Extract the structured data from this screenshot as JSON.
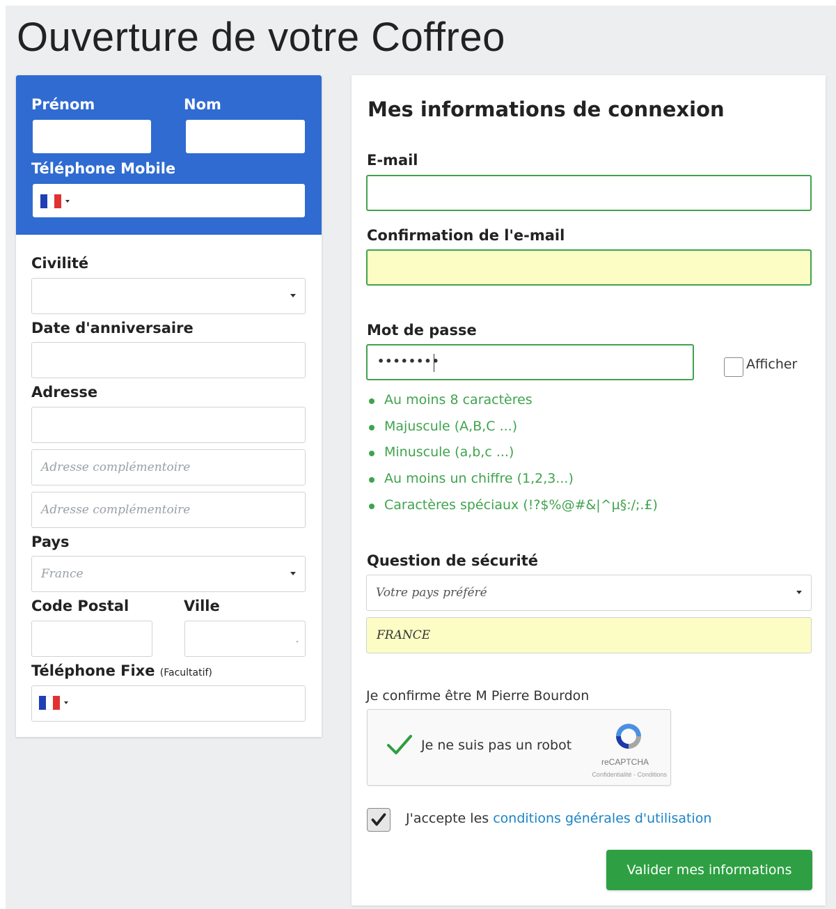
{
  "page": {
    "title": "Ouverture de votre Coffreo"
  },
  "left": {
    "prenom_label": "Prénom",
    "nom_label": "Nom",
    "mobile_label": "Téléphone Mobile",
    "civilite_label": "Civilité",
    "birthday_label": "Date d'anniversaire",
    "address_label": "Adresse",
    "address2_placeholder": "Adresse complémentoire",
    "address3_placeholder": "Adresse complémentoire",
    "country_label": "Pays",
    "country_value": "France",
    "postal_label": "Code Postal",
    "city_label": "Ville",
    "landline_label": "Téléphone Fixe",
    "landline_optional": "(Facultatif)"
  },
  "right": {
    "section_title": "Mes informations de connexion",
    "email_label": "E-mail",
    "email_confirm_label": "Confirmation de l'e-mail",
    "password_label": "Mot de passe",
    "password_value": "••••••••",
    "show_label": "Afficher",
    "password_rules": [
      "Au moins 8 caractères",
      "Majuscule (A,B,C ...)",
      "Minuscule (a,b,c ...)",
      "Au moins un chiffre (1,2,3...)",
      "Caractères spéciaux (!?$%@#&|^µ§:/;.£)"
    ],
    "security_label": "Question de sécurité",
    "security_question": "Votre pays préféré",
    "security_answer": "FRANCE",
    "confirm_identity": "Je confirme être M Pierre Bourdon",
    "captcha_text": "Je ne suis pas un robot",
    "captcha_brand": "reCAPTCHA",
    "captcha_legal": "Confidentialité - Conditions",
    "terms_prefix": "J'accepte les ",
    "terms_link": "conditions générales d'utilisation",
    "submit_label": "Valider mes informations"
  },
  "colors": {
    "header_blue": "#2f6bd1",
    "valid_green": "#3fa34d",
    "submit_green": "#2ea043",
    "autofill_yellow": "#fbfdc4",
    "link_blue": "#1a84c5"
  },
  "icons": {
    "flag": "france-flag-icon",
    "captcha_check": "green-checkmark-icon",
    "captcha_logo": "recaptcha-logo-icon",
    "terms_check": "checkmark-icon"
  }
}
